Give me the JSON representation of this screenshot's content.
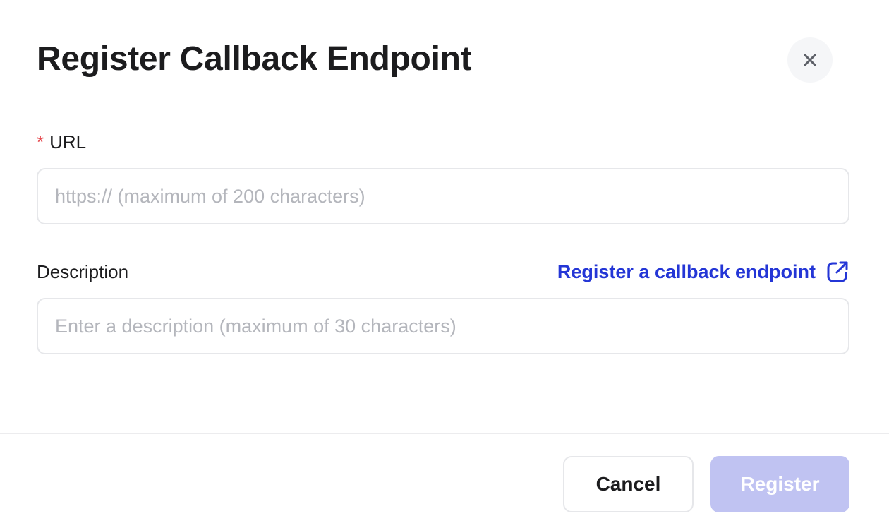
{
  "dialog": {
    "title": "Register Callback Endpoint",
    "close_icon": "close-icon"
  },
  "url_field": {
    "required_marker": "*",
    "label": "URL",
    "value": "",
    "placeholder": "https:// (maximum of 200 characters)"
  },
  "description_field": {
    "label": "Description",
    "value": "",
    "placeholder": "Enter a description (maximum of 30 characters)"
  },
  "help_link": {
    "label": "Register a callback endpoint",
    "icon": "external-link-icon"
  },
  "footer": {
    "cancel_label": "Cancel",
    "register_label": "Register",
    "register_enabled": false
  },
  "colors": {
    "link": "#2436d6",
    "required": "#e5484d",
    "register_disabled": "#c0c3f2"
  }
}
